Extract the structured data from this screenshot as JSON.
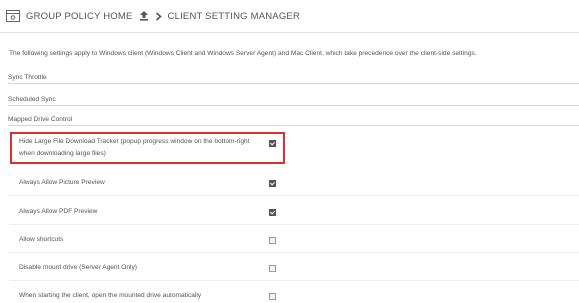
{
  "header": {
    "home_label": "GROUP POLICY HOME",
    "page_label": "CLIENT SETTING MANAGER"
  },
  "intro": "The following settings apply to Windows client (Windows Client and Windows Server Agent) and Mac Client, which take precedence over the client-side settings.",
  "sections": {
    "sync_throttle": "Sync Throttle",
    "scheduled_sync": "Scheduled Sync",
    "mapped_drive_control": "Mapped Drive Control"
  },
  "settings": [
    {
      "label": "Hide Large File Download Tracker (popup progress window on the bottom-right when downloading large files)",
      "checked": true
    },
    {
      "label": "Always Allow Picture Preview",
      "checked": true
    },
    {
      "label": "Always Allow PDF Preview",
      "checked": true
    },
    {
      "label": "Allow shortcuts",
      "checked": false
    },
    {
      "label": "Disable mount drive (Server Agent Only)",
      "checked": false
    },
    {
      "label": "When starting the client, open the mounted drive automatically",
      "checked": false
    }
  ],
  "colors": {
    "highlight": "#dc2f2f"
  },
  "icons": {
    "home": "group-policy-home-icon",
    "upload": "upload-icon",
    "separator": "chevron-right-icon"
  }
}
